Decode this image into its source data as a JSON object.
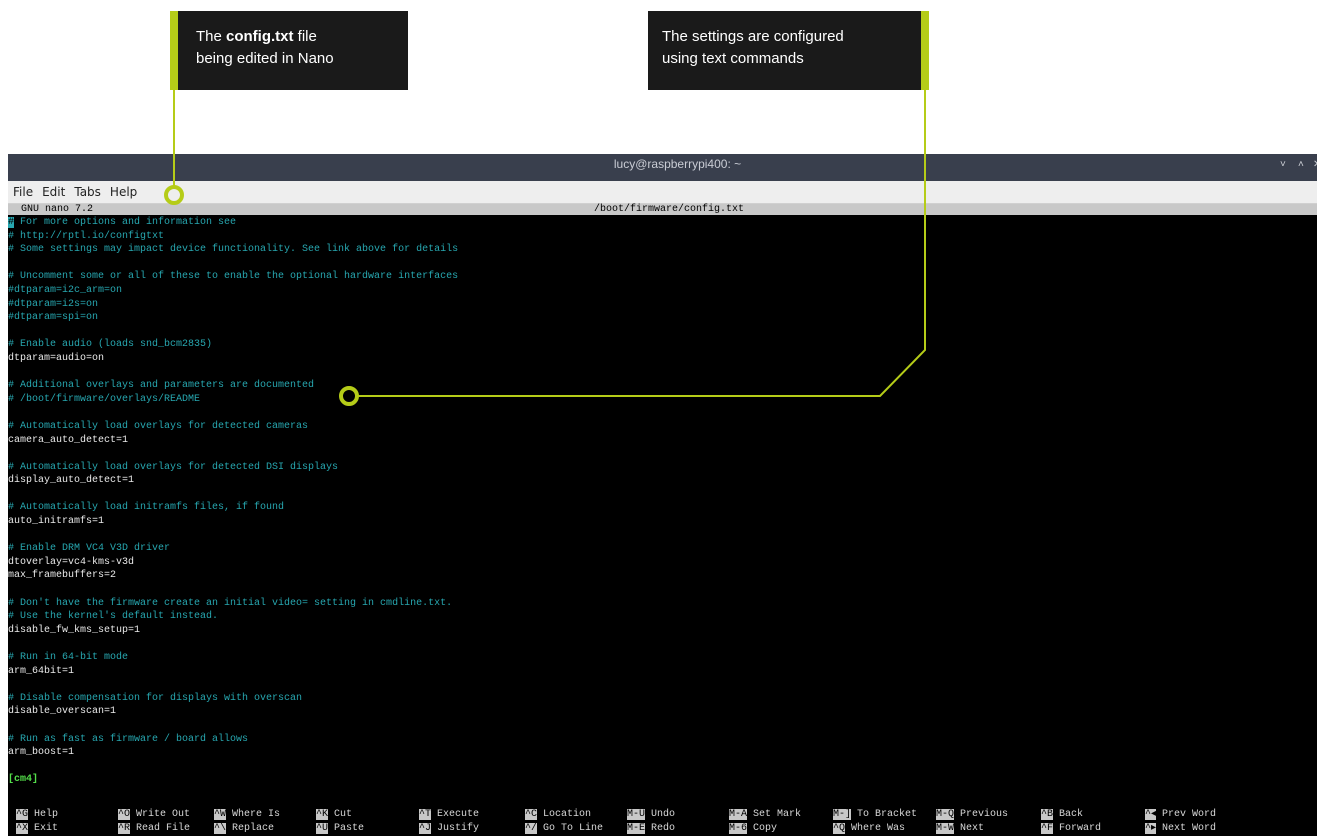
{
  "callouts": [
    {
      "line1_pre": "The ",
      "line1_bold": "config.txt",
      "line1_post": " file",
      "line2": "being edited in Nano"
    },
    {
      "line1": "The settings are configured",
      "line2": "using text commands"
    }
  ],
  "colors": {
    "accent": "#b5cc18",
    "comment": "#27a7b0",
    "terminal_bg": "#000000",
    "titlebar": "#393f4d"
  },
  "window": {
    "title": "lucy@raspberrypi400: ~",
    "controls": [
      "chevron-down-icon",
      "chevron-up-icon",
      "close-icon"
    ],
    "min_glyph": "˅",
    "max_glyph": "˄",
    "close_glyph": "✕"
  },
  "menu": {
    "items": [
      "File",
      "Edit",
      "Tabs",
      "Help"
    ]
  },
  "nano": {
    "version": "GNU nano 7.2",
    "file_path": "/boot/firmware/config.txt"
  },
  "lines": [
    {
      "type": "comment",
      "text": "# For more options and information see"
    },
    {
      "type": "comment",
      "text": "# http://rptl.io/configtxt"
    },
    {
      "type": "comment",
      "text": "# Some settings may impact device functionality. See link above for details"
    },
    {
      "type": "blank",
      "text": ""
    },
    {
      "type": "comment",
      "text": "# Uncomment some or all of these to enable the optional hardware interfaces"
    },
    {
      "type": "comment",
      "text": "#dtparam=i2c_arm=on"
    },
    {
      "type": "comment",
      "text": "#dtparam=i2s=on"
    },
    {
      "type": "comment",
      "text": "#dtparam=spi=on"
    },
    {
      "type": "blank",
      "text": ""
    },
    {
      "type": "comment",
      "text": "# Enable audio (loads snd_bcm2835)"
    },
    {
      "type": "setting",
      "text": "dtparam=audio=on"
    },
    {
      "type": "blank",
      "text": ""
    },
    {
      "type": "comment",
      "text": "# Additional overlays and parameters are documented"
    },
    {
      "type": "comment",
      "text": "# /boot/firmware/overlays/README"
    },
    {
      "type": "blank",
      "text": ""
    },
    {
      "type": "comment",
      "text": "# Automatically load overlays for detected cameras"
    },
    {
      "type": "setting",
      "text": "camera_auto_detect=1"
    },
    {
      "type": "blank",
      "text": ""
    },
    {
      "type": "comment",
      "text": "# Automatically load overlays for detected DSI displays"
    },
    {
      "type": "setting",
      "text": "display_auto_detect=1"
    },
    {
      "type": "blank",
      "text": ""
    },
    {
      "type": "comment",
      "text": "# Automatically load initramfs files, if found"
    },
    {
      "type": "setting",
      "text": "auto_initramfs=1"
    },
    {
      "type": "blank",
      "text": ""
    },
    {
      "type": "comment",
      "text": "# Enable DRM VC4 V3D driver"
    },
    {
      "type": "setting",
      "text": "dtoverlay=vc4-kms-v3d"
    },
    {
      "type": "setting",
      "text": "max_framebuffers=2"
    },
    {
      "type": "blank",
      "text": ""
    },
    {
      "type": "comment",
      "text": "# Don't have the firmware create an initial video= setting in cmdline.txt."
    },
    {
      "type": "comment",
      "text": "# Use the kernel's default instead."
    },
    {
      "type": "setting",
      "text": "disable_fw_kms_setup=1"
    },
    {
      "type": "blank",
      "text": ""
    },
    {
      "type": "comment",
      "text": "# Run in 64-bit mode"
    },
    {
      "type": "setting",
      "text": "arm_64bit=1"
    },
    {
      "type": "blank",
      "text": ""
    },
    {
      "type": "comment",
      "text": "# Disable compensation for displays with overscan"
    },
    {
      "type": "setting",
      "text": "disable_overscan=1"
    },
    {
      "type": "blank",
      "text": ""
    },
    {
      "type": "comment",
      "text": "# Run as fast as firmware / board allows"
    },
    {
      "type": "setting",
      "text": "arm_boost=1"
    },
    {
      "type": "blank",
      "text": ""
    },
    {
      "type": "section",
      "text": "[cm4]"
    }
  ],
  "shortcuts": [
    [
      {
        "key": "^G",
        "label": "Help"
      },
      {
        "key": "^X",
        "label": "Exit"
      }
    ],
    [
      {
        "key": "^O",
        "label": "Write Out"
      },
      {
        "key": "^R",
        "label": "Read File"
      }
    ],
    [
      {
        "key": "^W",
        "label": "Where Is"
      },
      {
        "key": "^\\",
        "label": "Replace"
      }
    ],
    [
      {
        "key": "^K",
        "label": "Cut"
      },
      {
        "key": "^U",
        "label": "Paste"
      }
    ],
    [
      {
        "key": "^T",
        "label": "Execute"
      },
      {
        "key": "^J",
        "label": "Justify"
      }
    ],
    [
      {
        "key": "^C",
        "label": "Location"
      },
      {
        "key": "^/",
        "label": "Go To Line"
      }
    ],
    [
      {
        "key": "M-U",
        "label": "Undo"
      },
      {
        "key": "M-E",
        "label": "Redo"
      }
    ],
    [
      {
        "key": "M-A",
        "label": "Set Mark"
      },
      {
        "key": "M-6",
        "label": "Copy"
      }
    ],
    [
      {
        "key": "M-]",
        "label": "To Bracket"
      },
      {
        "key": "^Q",
        "label": "Where Was"
      }
    ],
    [
      {
        "key": "M-Q",
        "label": "Previous"
      },
      {
        "key": "M-W",
        "label": "Next"
      }
    ],
    [
      {
        "key": "^B",
        "label": "Back"
      },
      {
        "key": "^F",
        "label": "Forward"
      }
    ],
    [
      {
        "key": "^◂",
        "label": "Prev Word"
      },
      {
        "key": "^▸",
        "label": "Next Word"
      }
    ]
  ]
}
